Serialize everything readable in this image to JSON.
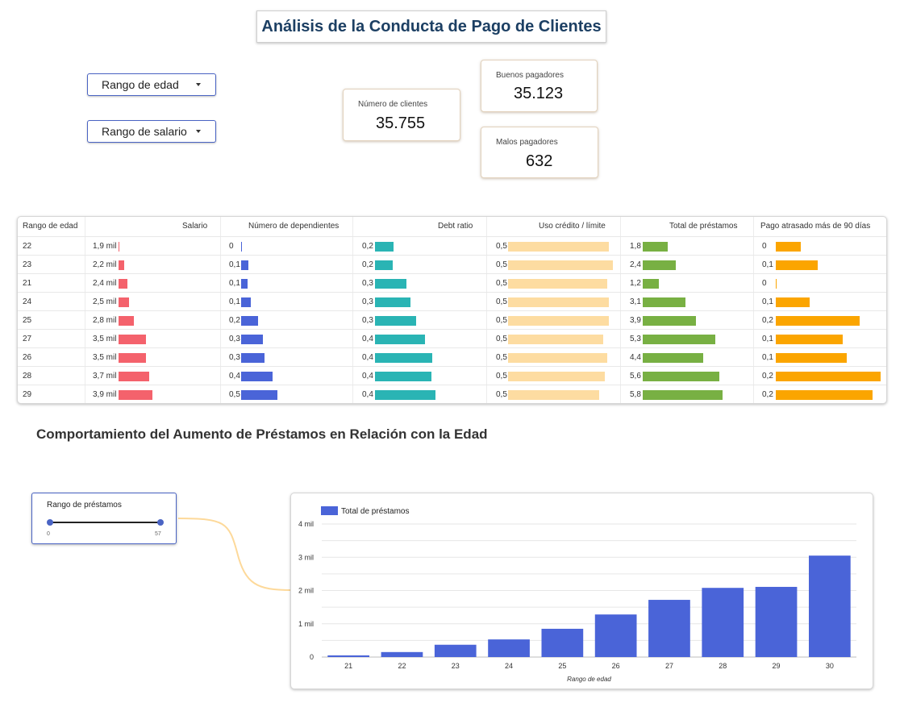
{
  "header": {
    "title": "Análisis de la Conducta de Pago de Clientes"
  },
  "filters": {
    "age_range": "Rango de edad",
    "salary_range": "Rango de salario"
  },
  "kpis": {
    "clients": {
      "label": "Número de clientes",
      "value": "35.755"
    },
    "good": {
      "label": "Buenos pagadores",
      "value": "35.123"
    },
    "bad": {
      "label": "Malos pagadores",
      "value": "632"
    }
  },
  "table": {
    "columns": [
      "Rango de edad",
      "Salario",
      "Número de dependientes",
      "Debt ratio",
      "Uso crédito / límite",
      "Total de préstamos",
      "Pago atrasado más de 90 días"
    ],
    "colors": {
      "salario": "#f4626c",
      "dependientes": "#4a64d8",
      "debt": "#2ab4b4",
      "uso": "#fddca1",
      "prestamos": "#78b043",
      "atrasado": "#fba500"
    },
    "rows": [
      {
        "edad": "22",
        "salario": "1,9 mil",
        "salario_v": 1.9,
        "dep": "0",
        "dep_v": 0.0,
        "debt": "0,2",
        "debt_v": 0.16,
        "uso": "0,5",
        "uso_v": 0.5,
        "prest": "1,8",
        "prest_v": 1.8,
        "atr": "0",
        "atr_v": 0.06
      },
      {
        "edad": "23",
        "salario": "2,2 mil",
        "salario_v": 2.2,
        "dep": "0,1",
        "dep_v": 0.09,
        "debt": "0,2",
        "debt_v": 0.15,
        "uso": "0,5",
        "uso_v": 0.52,
        "prest": "2,4",
        "prest_v": 2.4,
        "atr": "0,1",
        "atr_v": 0.1
      },
      {
        "edad": "21",
        "salario": "2,4 mil",
        "salario_v": 2.4,
        "dep": "0,1",
        "dep_v": 0.08,
        "debt": "0,3",
        "debt_v": 0.27,
        "uso": "0,5",
        "uso_v": 0.49,
        "prest": "1,2",
        "prest_v": 1.2,
        "atr": "0",
        "atr_v": 0.0
      },
      {
        "edad": "24",
        "salario": "2,5 mil",
        "salario_v": 2.5,
        "dep": "0,1",
        "dep_v": 0.11,
        "debt": "0,3",
        "debt_v": 0.3,
        "uso": "0,5",
        "uso_v": 0.5,
        "prest": "3,1",
        "prest_v": 3.1,
        "atr": "0,1",
        "atr_v": 0.08
      },
      {
        "edad": "25",
        "salario": "2,8 mil",
        "salario_v": 2.8,
        "dep": "0,2",
        "dep_v": 0.2,
        "debt": "0,3",
        "debt_v": 0.35,
        "uso": "0,5",
        "uso_v": 0.5,
        "prest": "3,9",
        "prest_v": 3.9,
        "atr": "0,2",
        "atr_v": 0.2
      },
      {
        "edad": "27",
        "salario": "3,5 mil",
        "salario_v": 3.5,
        "dep": "0,3",
        "dep_v": 0.26,
        "debt": "0,4",
        "debt_v": 0.43,
        "uso": "0,5",
        "uso_v": 0.47,
        "prest": "5,3",
        "prest_v": 5.3,
        "atr": "0,1",
        "atr_v": 0.16
      },
      {
        "edad": "26",
        "salario": "3,5 mil",
        "salario_v": 3.5,
        "dep": "0,3",
        "dep_v": 0.28,
        "debt": "0,4",
        "debt_v": 0.49,
        "uso": "0,5",
        "uso_v": 0.49,
        "prest": "4,4",
        "prest_v": 4.4,
        "atr": "0,1",
        "atr_v": 0.17
      },
      {
        "edad": "28",
        "salario": "3,7 mil",
        "salario_v": 3.7,
        "dep": "0,4",
        "dep_v": 0.37,
        "debt": "0,4",
        "debt_v": 0.48,
        "uso": "0,5",
        "uso_v": 0.48,
        "prest": "5,6",
        "prest_v": 5.6,
        "atr": "0,2",
        "atr_v": 0.25
      },
      {
        "edad": "29",
        "salario": "3,9 mil",
        "salario_v": 3.9,
        "dep": "0,5",
        "dep_v": 0.43,
        "debt": "0,4",
        "debt_v": 0.52,
        "uso": "0,5",
        "uso_v": 0.45,
        "prest": "5,8",
        "prest_v": 5.8,
        "atr": "0,2",
        "atr_v": 0.23
      }
    ]
  },
  "section": {
    "title": "Comportamiento del Aumento de Préstamos en Relación con la Edad"
  },
  "slider": {
    "label": "Rango de préstamos",
    "min": "0",
    "max": "57",
    "low": 0,
    "high": 57
  },
  "chart_data": {
    "type": "bar",
    "title": "",
    "xlabel": "Rango de edad",
    "ylabel": "",
    "categories": [
      "21",
      "22",
      "23",
      "24",
      "25",
      "26",
      "27",
      "28",
      "29",
      "30"
    ],
    "series": [
      {
        "name": "Total de préstamos",
        "color": "#4a64d8",
        "values": [
          50,
          150,
          370,
          530,
          850,
          1280,
          1720,
          2080,
          2110,
          3050
        ]
      }
    ],
    "ylim": [
      0,
      4000
    ],
    "yticks": [
      0,
      1000,
      2000,
      3000,
      4000
    ],
    "ytick_labels": [
      "0",
      "1 mil",
      "2 mil",
      "3 mil",
      "4 mil"
    ],
    "legend": "top-left",
    "grid": true
  }
}
